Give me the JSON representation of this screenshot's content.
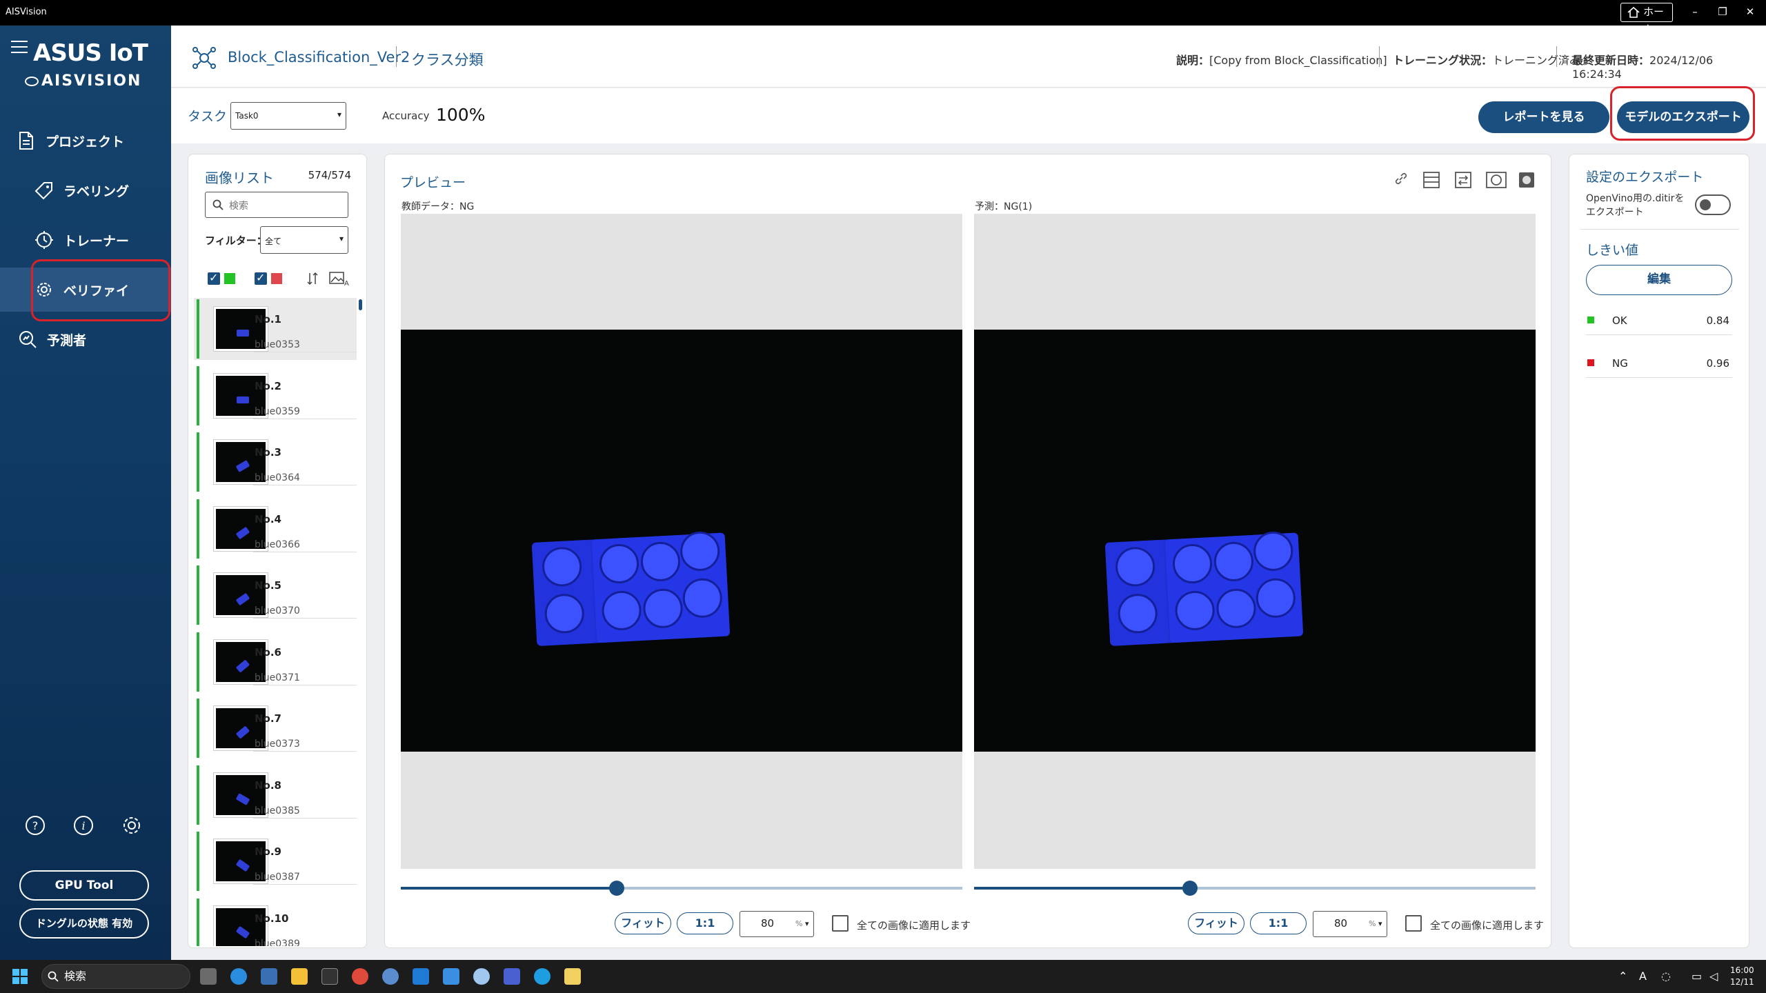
{
  "window": {
    "app_name": "AISVision",
    "home_label": "ホーム",
    "min": "–",
    "restore": "❐",
    "close": "✕"
  },
  "sidebar": {
    "logo_line1": "ASUS IoT",
    "logo_line2": "AISVISION",
    "items": [
      {
        "label": "プロジェクト",
        "icon": "document-icon"
      },
      {
        "label": "ラベリング",
        "icon": "tag-icon"
      },
      {
        "label": "トレーナー",
        "icon": "clock-chip-icon"
      },
      {
        "label": "ベリファイ",
        "icon": "gear-check-icon",
        "active": true
      },
      {
        "label": "予測者",
        "icon": "magnifier-chart-icon"
      }
    ],
    "help_icon": "?",
    "info_icon": "i",
    "gpu_tool": "GPU Tool",
    "dongle_status": "ドングルの状態 有効"
  },
  "header": {
    "project_name": "Block_Classification_Ver2",
    "project_type": "クラス分類",
    "description_label": "説明：",
    "description_value": "[Copy from Block_Classification]",
    "training_label": "トレーニング状況：",
    "training_value": "トレーニング済み",
    "updated_label": "最終更新日時：",
    "updated_value": "2024/12/06 16:24:34"
  },
  "toolbar": {
    "task_label": "タスク",
    "task_value": "Task0",
    "accuracy_label": "Accuracy",
    "accuracy_value": "100%",
    "report_button": "レポートを見る",
    "export_button": "モデルのエクスポート"
  },
  "image_list": {
    "title": "画像リスト",
    "count": "574/574",
    "search_placeholder": "検索",
    "filter_label": "フィルター：",
    "filter_value": "全て",
    "items": [
      {
        "num": "No.1",
        "name": "blue0353"
      },
      {
        "num": "No.2",
        "name": "blue0359"
      },
      {
        "num": "No.3",
        "name": "blue0364"
      },
      {
        "num": "No.4",
        "name": "blue0366"
      },
      {
        "num": "No.5",
        "name": "blue0370"
      },
      {
        "num": "No.6",
        "name": "blue0371"
      },
      {
        "num": "No.7",
        "name": "blue0373"
      },
      {
        "num": "No.8",
        "name": "blue0385"
      },
      {
        "num": "No.9",
        "name": "blue0387"
      },
      {
        "num": "No.10",
        "name": "blue0389"
      }
    ]
  },
  "preview": {
    "title": "プレビュー",
    "left_label": "教師データ：NG",
    "right_label": "予測：NG(1)",
    "fit_button": "フィット",
    "one_to_one": "1:1",
    "zoom_value": "80",
    "zoom_unit": "%",
    "apply_all": "全ての画像に適用します",
    "slider_level": 0.385
  },
  "settings": {
    "export_title": "設定のエクスポート",
    "openvino_label": "OpenVino用の.ditirをエクスポート",
    "threshold_title": "しきい値",
    "edit_button": "編集",
    "thresholds": [
      {
        "name": "OK",
        "value": "0.84",
        "color": "#22c322"
      },
      {
        "name": "NG",
        "value": "0.96",
        "color": "#e0141e"
      }
    ]
  },
  "taskbar": {
    "search": "検索",
    "time": "16:00",
    "date": "12/11",
    "ime": "A"
  }
}
